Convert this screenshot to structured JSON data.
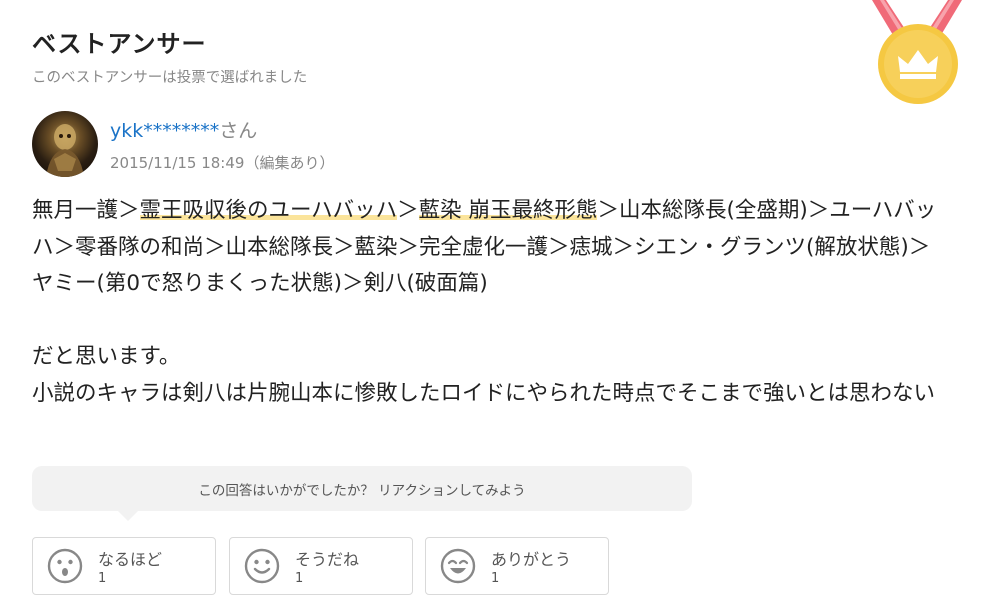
{
  "header": {
    "title": "ベストアンサー",
    "subtitle": "このベストアンサーは投票で選ばれました"
  },
  "answerer": {
    "name": "ykk********",
    "honorific": "さん",
    "timestamp": "2015/11/15 18:49（編集あり）"
  },
  "answer": {
    "p1_part1": "無月一護＞",
    "p1_hl1": "霊王吸収後のユーハバッハ",
    "p1_part2": "＞",
    "p1_hl2": "藍染 崩玉最終形態",
    "p1_part3": "＞山本総隊長(全盛期)＞ユーハバッハ＞零番隊の和尚＞山本総隊長＞藍染＞完全虚化一護＞痣城＞シエン・グランツ(解放状態)＞ ヤミー(第0で怒りまくった状態)＞剣八(破面篇)",
    "line2": "だと思います。",
    "line3": "小説のキャラは剣八は片腕山本に惨敗したロイドにやられた時点でそこまで強いとは思わない"
  },
  "reaction_prompt": "この回答はいかがでしたか？ リアクションしてみよう",
  "reactions": [
    {
      "label": "なるほど",
      "count": "1",
      "icon": "surprised-face-icon"
    },
    {
      "label": "そうだね",
      "count": "1",
      "icon": "smile-face-icon"
    },
    {
      "label": "ありがとう",
      "count": "1",
      "icon": "grin-face-icon"
    }
  ],
  "colors": {
    "link": "#1a73c7",
    "highlight": "#fbe49b",
    "medal": "#f5c842",
    "ribbon": "#f06a78"
  }
}
